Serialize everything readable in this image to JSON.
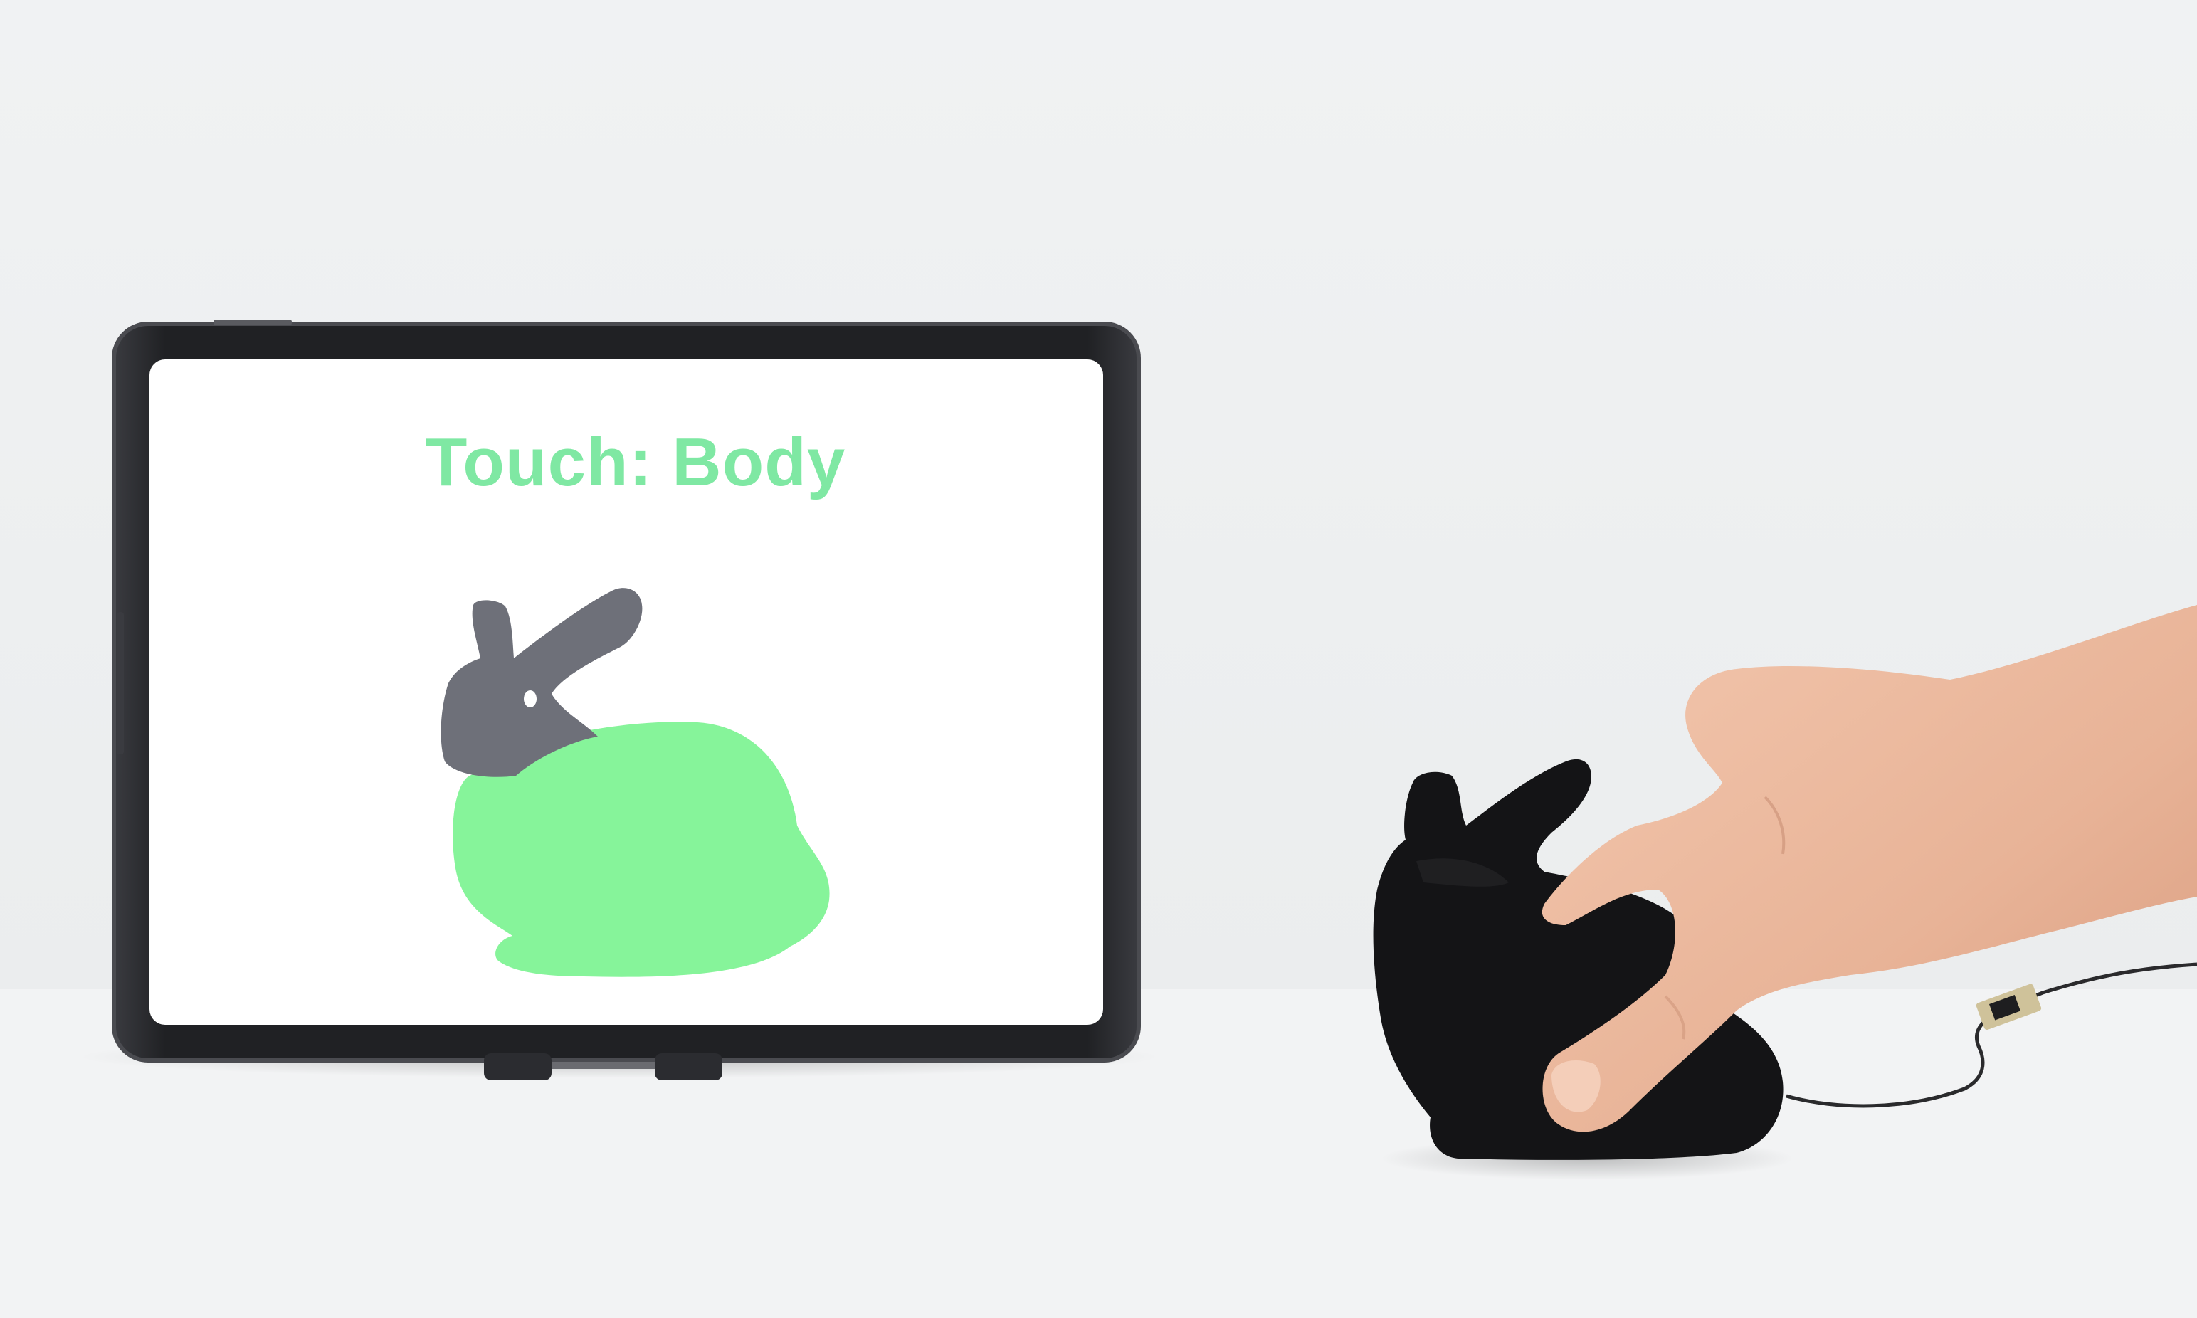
{
  "tablet": {
    "touch_label": "Touch: Body",
    "label_color": "#7fe8a3",
    "screen_background": "#ffffff",
    "bezel_color": "#222326"
  },
  "bunny": {
    "parts": [
      {
        "name": "head",
        "color": "#6e7079",
        "touched": false
      },
      {
        "name": "body",
        "color": "#86f49a",
        "touched": true
      }
    ]
  },
  "icons": {
    "bunny_illustration": "bunny-silhouette",
    "physical_object": "black-foam-bunny",
    "hand": "pointing-hand",
    "cable": "sensor-cable"
  },
  "colors": {
    "wall": "#eff1f2",
    "table": "#f1f2f3",
    "foam": "#141416",
    "skin": "#e9b79c"
  }
}
